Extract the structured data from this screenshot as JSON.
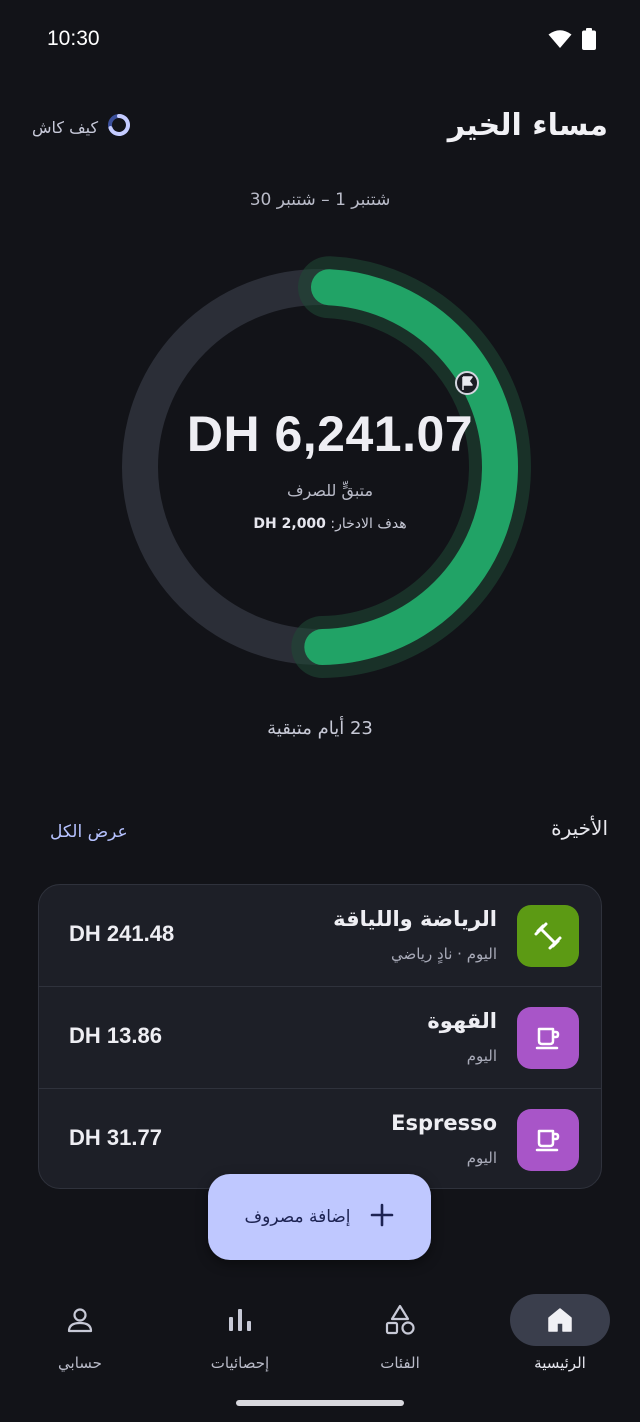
{
  "status_bar": {
    "time": "10:30"
  },
  "header": {
    "greeting": "مساء الخير",
    "brand": "كيف كاش"
  },
  "summary": {
    "period": "شتنبر 1 – شتنبر 30",
    "amount": "DH 6,241.07",
    "amount_label": "متبقٍّ للصرف",
    "goal_label": "هدف الادخار:",
    "goal_value": "DH 2,000",
    "days_left": "23 أيام متبقية",
    "remaining_fraction": 0.49,
    "colors": {
      "progress": "#21a366",
      "track": "#2b2e37"
    }
  },
  "recent": {
    "title": "الأخيرة",
    "view_all": "عرض الكل",
    "transactions": [
      {
        "title": "الرياضة واللياقة",
        "subtitle": "اليوم · نادٍ رياضي",
        "amount": "DH 241.48",
        "icon": "dumbbell-icon",
        "color": "#5c9a14"
      },
      {
        "title": "القهوة",
        "subtitle": "اليوم",
        "amount": "DH 13.86",
        "icon": "coffee-cup-icon",
        "color": "#a855c8"
      },
      {
        "title": "Espresso",
        "subtitle": "اليوم",
        "amount": "DH 31.77",
        "icon": "coffee-cup-icon",
        "color": "#a855c8"
      }
    ]
  },
  "fab": {
    "label": "إضافة مصروف"
  },
  "nav": {
    "items": [
      {
        "label": "الرئيسية",
        "icon": "home-icon",
        "active": true
      },
      {
        "label": "الفئات",
        "icon": "categories-icon",
        "active": false
      },
      {
        "label": "إحصائيات",
        "icon": "stats-icon",
        "active": false
      },
      {
        "label": "حسابي",
        "icon": "profile-icon",
        "active": false
      }
    ]
  }
}
